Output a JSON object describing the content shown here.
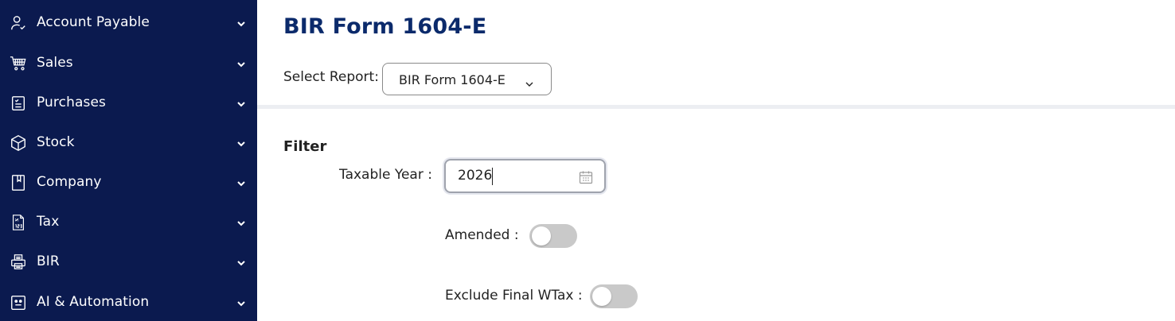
{
  "sidebar": {
    "items": [
      {
        "label": "Account Payable",
        "icon": "person-check-icon"
      },
      {
        "label": "Sales",
        "icon": "cart-icon"
      },
      {
        "label": "Purchases",
        "icon": "clipboard-icon"
      },
      {
        "label": "Stock",
        "icon": "box-icon"
      },
      {
        "label": "Company",
        "icon": "book-icon"
      },
      {
        "label": "Tax",
        "icon": "tax-document-icon"
      },
      {
        "label": "BIR",
        "icon": "printer-icon"
      },
      {
        "label": "AI & Automation",
        "icon": "robot-icon"
      }
    ]
  },
  "header": {
    "title": "BIR Form 1604-E",
    "select_label": "Select Report:",
    "select_value": "BIR Form 1604-E"
  },
  "filter": {
    "heading": "Filter",
    "taxable_year_label": "Taxable Year :",
    "taxable_year_value": "2026",
    "amended_label": "Amended :",
    "amended_on": false,
    "exclude_final_wtax_label": "Exclude Final WTax :",
    "exclude_final_wtax_on": false
  },
  "colors": {
    "sidebar_bg": "#0b1a4f",
    "title": "#0b2a6b",
    "toggle_off": "#c9c9c9"
  }
}
